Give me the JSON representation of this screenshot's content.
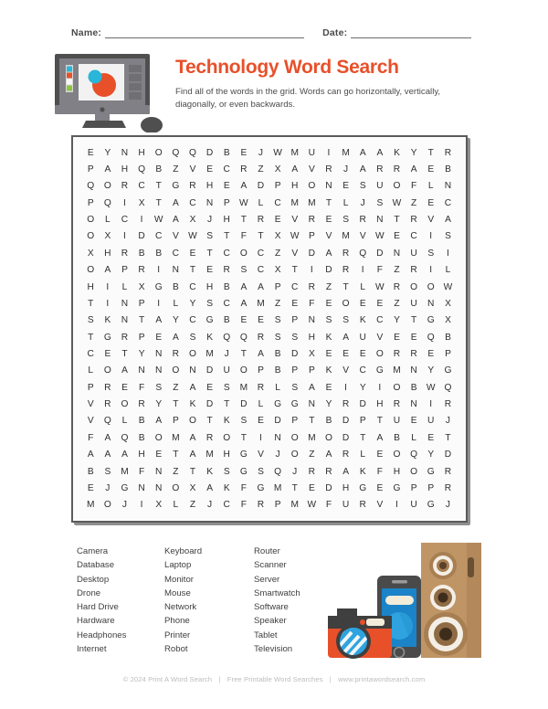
{
  "header": {
    "name_label": "Name:",
    "date_label": "Date:"
  },
  "title": "Technology Word Search",
  "description": "Find all of the words in the grid. Words can go horizontally, vertically, diagonally, or even backwards.",
  "colors": {
    "title_orange": "#e8502a",
    "grid_border": "#5b5b5b",
    "text": "#3f3f3f",
    "footer": "#bcbcbc",
    "monitor_dark": "#4f4f4f",
    "monitor_body": "#808086",
    "accent_blue": "#29b6d8",
    "speaker_brown": "#b3895c"
  },
  "grid": {
    "rows": 22,
    "cols": 22,
    "letters": [
      [
        "E",
        "Y",
        "N",
        "H",
        "O",
        "Q",
        "Q",
        "D",
        "B",
        "E",
        "J",
        "W",
        "M",
        "U",
        "I",
        "M",
        "A",
        "A",
        "K",
        "Y",
        "T",
        "R"
      ],
      [
        "P",
        "A",
        "H",
        "Q",
        "B",
        "Z",
        "V",
        "E",
        "C",
        "R",
        "Z",
        "X",
        "A",
        "V",
        "R",
        "J",
        "A",
        "R",
        "R",
        "A",
        "E",
        "B"
      ],
      [
        "Q",
        "O",
        "R",
        "C",
        "T",
        "G",
        "R",
        "H",
        "E",
        "A",
        "D",
        "P",
        "H",
        "O",
        "N",
        "E",
        "S",
        "U",
        "O",
        "F",
        "L",
        "N"
      ],
      [
        "P",
        "Q",
        "I",
        "X",
        "T",
        "A",
        "C",
        "N",
        "P",
        "W",
        "L",
        "C",
        "M",
        "M",
        "T",
        "L",
        "J",
        "S",
        "W",
        "Z",
        "E",
        "C"
      ],
      [
        "O",
        "L",
        "C",
        "I",
        "W",
        "A",
        "X",
        "J",
        "H",
        "T",
        "R",
        "E",
        "V",
        "R",
        "E",
        "S",
        "R",
        "N",
        "T",
        "R",
        "V",
        "A"
      ],
      [
        "O",
        "X",
        "I",
        "D",
        "C",
        "V",
        "W",
        "S",
        "T",
        "F",
        "T",
        "X",
        "W",
        "P",
        "V",
        "M",
        "V",
        "W",
        "E",
        "C",
        "I",
        "S"
      ],
      [
        "X",
        "H",
        "R",
        "B",
        "B",
        "C",
        "E",
        "T",
        "C",
        "O",
        "C",
        "Z",
        "V",
        "D",
        "A",
        "R",
        "Q",
        "D",
        "N",
        "U",
        "S",
        "I"
      ],
      [
        "O",
        "A",
        "P",
        "R",
        "I",
        "N",
        "T",
        "E",
        "R",
        "S",
        "C",
        "X",
        "T",
        "I",
        "D",
        "R",
        "I",
        "F",
        "Z",
        "R",
        "I",
        "L"
      ],
      [
        "H",
        "I",
        "L",
        "X",
        "G",
        "B",
        "C",
        "H",
        "B",
        "A",
        "A",
        "P",
        "C",
        "R",
        "Z",
        "T",
        "L",
        "W",
        "R",
        "O",
        "O",
        "W"
      ],
      [
        "T",
        "I",
        "N",
        "P",
        "I",
        "L",
        "Y",
        "S",
        "C",
        "A",
        "M",
        "Z",
        "E",
        "F",
        "E",
        "O",
        "E",
        "E",
        "Z",
        "U",
        "N",
        "X"
      ],
      [
        "S",
        "K",
        "N",
        "T",
        "A",
        "Y",
        "C",
        "G",
        "B",
        "E",
        "E",
        "S",
        "P",
        "N",
        "S",
        "S",
        "K",
        "C",
        "Y",
        "T",
        "G",
        "X"
      ],
      [
        "T",
        "G",
        "R",
        "P",
        "E",
        "A",
        "S",
        "K",
        "Q",
        "Q",
        "R",
        "S",
        "S",
        "H",
        "K",
        "A",
        "U",
        "V",
        "E",
        "E",
        "Q",
        "B"
      ],
      [
        "C",
        "E",
        "T",
        "Y",
        "N",
        "R",
        "O",
        "M",
        "J",
        "T",
        "A",
        "B",
        "D",
        "X",
        "E",
        "E",
        "E",
        "O",
        "R",
        "R",
        "E",
        "P"
      ],
      [
        "L",
        "O",
        "A",
        "N",
        "N",
        "O",
        "N",
        "D",
        "U",
        "O",
        "P",
        "B",
        "P",
        "P",
        "K",
        "V",
        "C",
        "G",
        "M",
        "N",
        "Y",
        "G"
      ],
      [
        "P",
        "R",
        "E",
        "F",
        "S",
        "Z",
        "A",
        "E",
        "S",
        "M",
        "R",
        "L",
        "S",
        "A",
        "E",
        "I",
        "Y",
        "I",
        "O",
        "B",
        "W",
        "Q"
      ],
      [
        "V",
        "R",
        "O",
        "R",
        "Y",
        "T",
        "K",
        "D",
        "T",
        "D",
        "L",
        "G",
        "G",
        "N",
        "Y",
        "R",
        "D",
        "H",
        "R",
        "N",
        "I",
        "R"
      ],
      [
        "V",
        "Q",
        "L",
        "B",
        "A",
        "P",
        "O",
        "T",
        "K",
        "S",
        "E",
        "D",
        "P",
        "T",
        "B",
        "D",
        "P",
        "T",
        "U",
        "E",
        "U",
        "J"
      ],
      [
        "F",
        "A",
        "Q",
        "B",
        "O",
        "M",
        "A",
        "R",
        "O",
        "T",
        "I",
        "N",
        "O",
        "M",
        "O",
        "D",
        "T",
        "A",
        "B",
        "L",
        "E",
        "T"
      ],
      [
        "A",
        "A",
        "A",
        "H",
        "E",
        "T",
        "A",
        "M",
        "H",
        "G",
        "V",
        "J",
        "O",
        "Z",
        "A",
        "R",
        "L",
        "E",
        "O",
        "Q",
        "Y",
        "D"
      ],
      [
        "B",
        "S",
        "M",
        "F",
        "N",
        "Z",
        "T",
        "K",
        "S",
        "G",
        "S",
        "Q",
        "J",
        "R",
        "R",
        "A",
        "K",
        "F",
        "H",
        "O",
        "G",
        "R"
      ],
      [
        "E",
        "J",
        "G",
        "N",
        "N",
        "O",
        "X",
        "A",
        "K",
        "F",
        "G",
        "M",
        "T",
        "E",
        "D",
        "H",
        "G",
        "E",
        "G",
        "P",
        "P",
        "R"
      ],
      [
        "M",
        "O",
        "J",
        "I",
        "X",
        "L",
        "Z",
        "J",
        "C",
        "F",
        "R",
        "P",
        "M",
        "W",
        "F",
        "U",
        "R",
        "V",
        "I",
        "U",
        "G",
        "J"
      ]
    ]
  },
  "word_list": {
    "columns": [
      [
        "Camera",
        "Database",
        "Desktop",
        "Drone",
        "Hard Drive",
        "Hardware",
        "Headphones",
        "Internet"
      ],
      [
        "Keyboard",
        "Laptop",
        "Monitor",
        "Mouse",
        "Network",
        "Phone",
        "Printer",
        "Robot"
      ],
      [
        "Router",
        "Scanner",
        "Server",
        "Smartwatch",
        "Software",
        "Speaker",
        "Tablet",
        "Television"
      ]
    ]
  },
  "footer": {
    "copyright": "© 2024 Print A Word Search",
    "tagline": "Free Printable Word Searches",
    "website": "www.printawordsearch.com",
    "separator": "|"
  }
}
